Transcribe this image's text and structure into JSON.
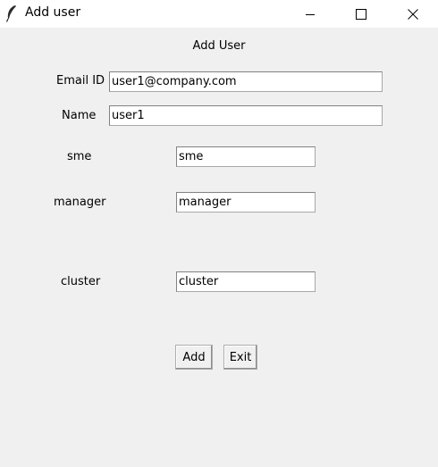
{
  "window": {
    "title": "Add user",
    "icon": "feather-icon",
    "controls": [
      "minimize-icon",
      "maximize-icon",
      "close-icon"
    ]
  },
  "form": {
    "heading": "Add User",
    "email": {
      "label": "Email ID",
      "value": "user1@company.com"
    },
    "name": {
      "label": "Name",
      "value": "user1"
    },
    "sme": {
      "label": "sme",
      "value": "sme"
    },
    "manager": {
      "label": "manager",
      "value": "manager"
    },
    "cluster": {
      "label": "cluster",
      "value": "cluster"
    }
  },
  "buttons": {
    "add": "Add",
    "exit": "Exit"
  }
}
